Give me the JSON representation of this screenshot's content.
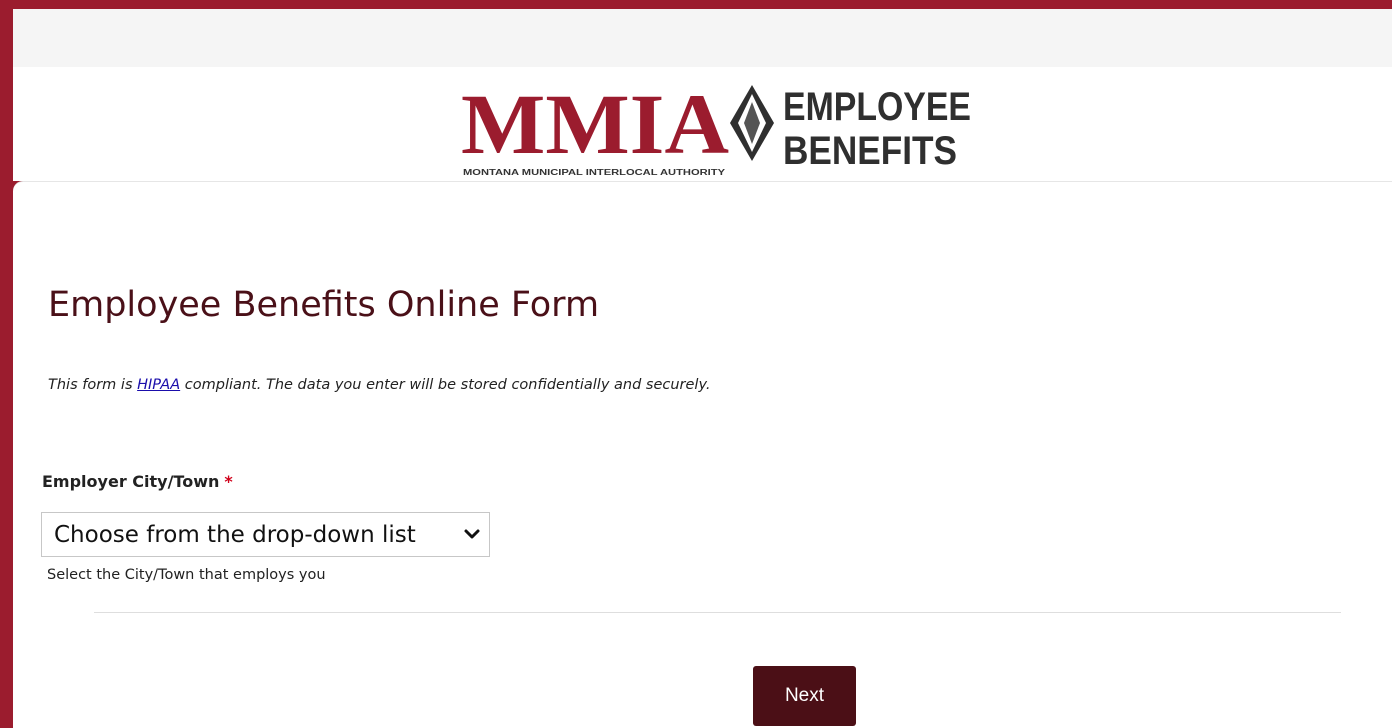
{
  "header": {
    "logo_main": "MMIA",
    "logo_sub": "MONTANA MUNICIPAL INTERLOCAL AUTHORITY",
    "logo_right_line1": "EMPLOYEE",
    "logo_right_line2": "BENEFITS"
  },
  "form": {
    "title": "Employee Benefits Online Form",
    "notice_prefix": "This form is ",
    "notice_link": "HIPAA",
    "notice_suffix": " compliant.  The data you enter will be stored confidentially and securely.",
    "field": {
      "label": "Employer City/Town",
      "required_mark": "*",
      "selected_value": "Choose from the drop-down list",
      "help_text": "Select the City/Town that employs you"
    },
    "next_label": "Next"
  },
  "colors": {
    "brand_red": "#9b1c2e",
    "title_maroon": "#4a1018",
    "button_bg": "#4b0f16",
    "link_blue": "#1a0dab",
    "required_red": "#d0021b"
  },
  "icons": {
    "logo_emblem": "diamond-emblem-icon",
    "select_arrow": "chevron-down-icon"
  }
}
